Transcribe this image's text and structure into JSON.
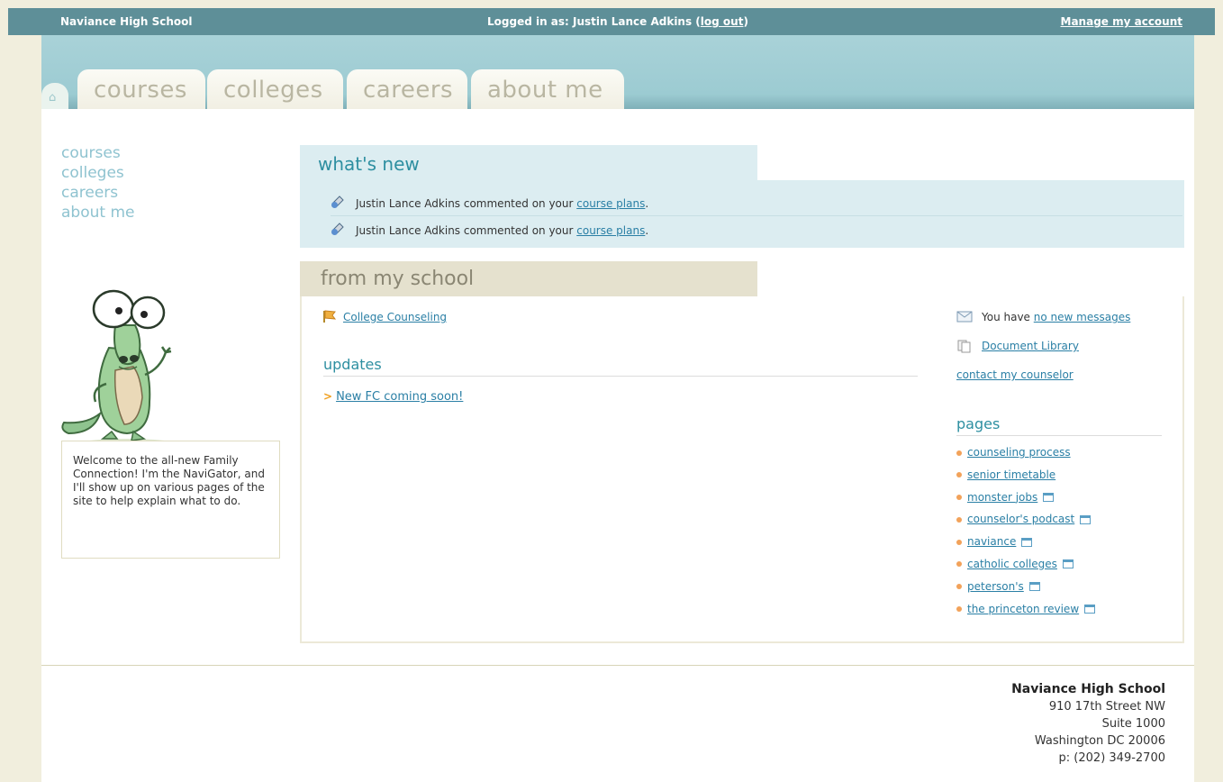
{
  "topbar": {
    "school_name": "Naviance High School",
    "login_prefix": "Logged in as: Justin Lance Adkins (",
    "logout_label": "log out",
    "login_suffix": ")",
    "manage_label": "Manage my account",
    "bg_color": "#5e8f98"
  },
  "tabs": [
    "courses",
    "colleges",
    "careers",
    "about me"
  ],
  "sidenav": [
    "courses",
    "colleges",
    "careers",
    "about me"
  ],
  "navigator": {
    "message": "Welcome to the all-new Family Connection! I'm the NaviGator, and I'll show up on various pages of the site to help explain what to do."
  },
  "whats_new": {
    "title": "what's new",
    "items": [
      {
        "text": "Justin Lance Adkins commented on your ",
        "link": "course plans",
        "end": "."
      },
      {
        "text": "Justin Lance Adkins commented on your ",
        "link": "course plans",
        "end": "."
      }
    ]
  },
  "from_my_school": {
    "title": "from my school",
    "college_counseling": "College Counseling",
    "updates_title": "updates",
    "update_item": "New FC coming soon!",
    "messages_prefix": "You have ",
    "messages_link": "no new messages",
    "document_library": "Document Library",
    "contact_counselor": "contact my counselor",
    "pages_title": "pages",
    "pages": [
      {
        "label": "counseling process",
        "external": false
      },
      {
        "label": "senior timetable",
        "external": false
      },
      {
        "label": "monster jobs",
        "external": true
      },
      {
        "label": "counselor's podcast",
        "external": true
      },
      {
        "label": "naviance",
        "external": true
      },
      {
        "label": "catholic colleges",
        "external": true
      },
      {
        "label": "peterson's",
        "external": true
      },
      {
        "label": "the princeton review",
        "external": true
      }
    ]
  },
  "footer": {
    "school": "Naviance High School",
    "street": "910 17th Street NW",
    "suite": "Suite 1000",
    "city": "Washington DC 20006",
    "phone": "p: (202) 349-2700"
  },
  "colors": {
    "accent": "#2e8fa1",
    "link": "#2a7fa5",
    "page_bg": "#f1eedd",
    "banner": "#a9d2d8"
  }
}
